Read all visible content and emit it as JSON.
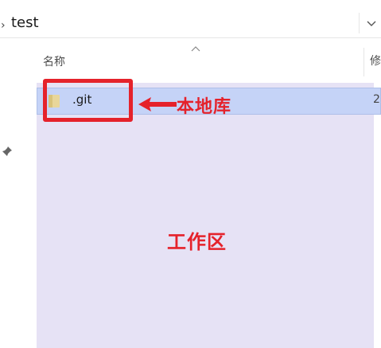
{
  "address_bar": {
    "path": "test",
    "separator": "›",
    "chevron_icon": "chevron-down-icon"
  },
  "columns": {
    "name_label": "名称",
    "modified_label_partial": "修"
  },
  "files": [
    {
      "name": ".git",
      "date_partial": "2",
      "icon": "folder-icon"
    }
  ],
  "annotations": {
    "local_repo": "本地库",
    "working_dir": "工作区",
    "highlight_color": "#e5222b"
  },
  "colors": {
    "selection_bg": "#c5d3f7",
    "work_area_bg": "#e6e2f5"
  }
}
